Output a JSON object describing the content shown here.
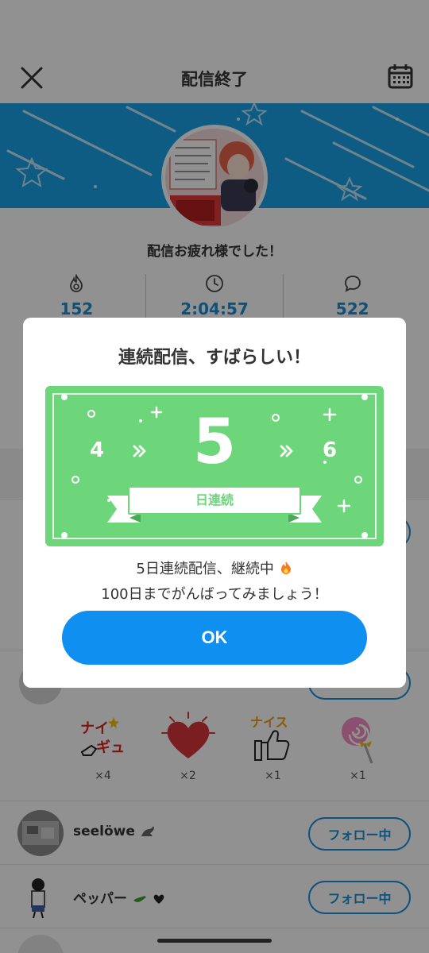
{
  "header": {
    "title": "配信終了"
  },
  "profile": {
    "thanks_text": "配信お疲れ様でした！"
  },
  "stats": [
    {
      "icon": "flame-icon",
      "value": "152"
    },
    {
      "icon": "clock-icon",
      "value": "2:04:57"
    },
    {
      "icon": "comment-icon",
      "value": "522"
    }
  ],
  "gifts": [
    {
      "icon": "nice-sticker-icon",
      "count": "×4"
    },
    {
      "icon": "heart-icon",
      "count": "×2"
    },
    {
      "icon": "thumbs-up-nice-icon",
      "count": "×1"
    },
    {
      "icon": "lollipop-icon",
      "count": "×1"
    }
  ],
  "users": [
    {
      "name": "seelöwe",
      "follow_label": "フォロー中"
    },
    {
      "name": "ペッパー",
      "follow_label": "フォロー中"
    }
  ],
  "modal": {
    "title": "連続配信、すばらしい！",
    "streak_prev": "4",
    "streak_current": "5",
    "streak_next": "6",
    "streak_unit": "日連続",
    "message_line1": "5日連続配信、継続中",
    "message_line2": "100日までがんばってみましょう！",
    "ok_label": "OK"
  },
  "colors": {
    "accent_blue": "#1a8fd8",
    "ok_button": "#0f8ff0",
    "banner": "#1aa3e8",
    "streak_green": "#6dd67b"
  }
}
